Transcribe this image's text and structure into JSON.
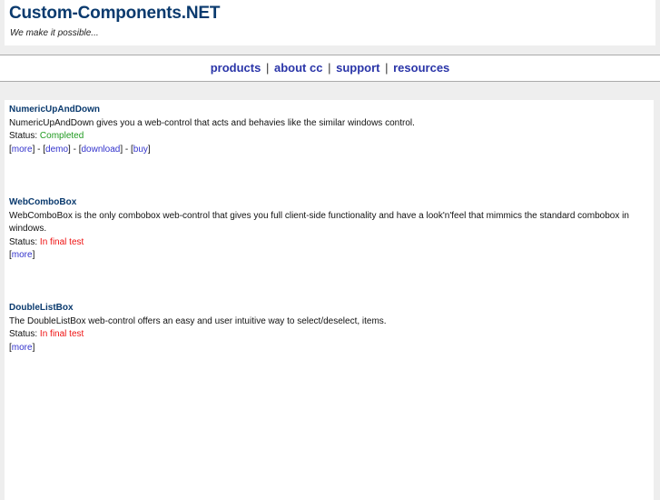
{
  "header": {
    "title": "Custom-Components.NET",
    "tagline": "We make it possible..."
  },
  "nav": {
    "items": [
      {
        "label": "products"
      },
      {
        "label": "about cc"
      },
      {
        "label": "support"
      },
      {
        "label": "resources"
      }
    ],
    "separator": "|"
  },
  "colors": {
    "title": "#0a3a6e",
    "nav_link": "#2a35a8",
    "status_completed": "#1f9a1f",
    "status_in_final_test": "#ee1111",
    "link": "#3333cc",
    "page_background": "#eeeeee"
  },
  "products": [
    {
      "name": "NumericUpAndDown",
      "description": "NumericUpAndDown gives you a web-control that acts and behavies like the similar windows control.",
      "status_label": "Status:",
      "status": "Completed",
      "links": [
        "more",
        "demo",
        "download",
        "buy"
      ]
    },
    {
      "name": "WebComboBox",
      "description": "WebComboBox is the only combobox web-control that gives you full client-side functionality and have a look'n'feel that mimmics the standard combobox in windows.",
      "status_label": "Status:",
      "status": "In final test",
      "links": [
        "more"
      ]
    },
    {
      "name": "DoubleListBox",
      "description": "The DoubleListBox web-control offers an easy and user intuitive way to select/deselect, items.",
      "status_label": "Status:",
      "status": "In final test",
      "links": [
        "more"
      ]
    }
  ]
}
